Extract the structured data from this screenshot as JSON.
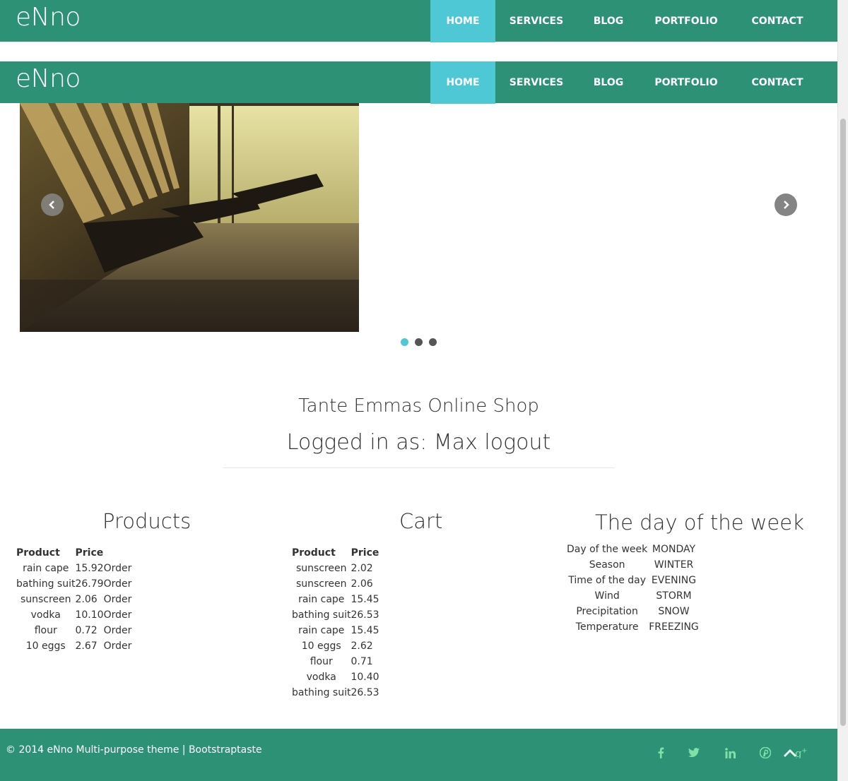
{
  "brand": "eNno",
  "nav": {
    "items": [
      {
        "label": "HOME",
        "active": true
      },
      {
        "label": "SERVICES",
        "active": false
      },
      {
        "label": "BLOG",
        "active": false
      },
      {
        "label": "PORTFOLIO",
        "active": false
      },
      {
        "label": "CONTACT",
        "active": false
      }
    ]
  },
  "carousel": {
    "slide_count": 3,
    "active_index": 0
  },
  "shop": {
    "title": "Tante Emmas Online Shop",
    "login_line": "Logged in as: Max logout"
  },
  "products": {
    "title": "Products",
    "headers": [
      "Product",
      "Price"
    ],
    "rows": [
      {
        "name": "rain cape",
        "price": "15.92",
        "action": "Order"
      },
      {
        "name": "bathing suit",
        "price": "26.79",
        "action": "Order"
      },
      {
        "name": "sunscreen",
        "price": "2.06",
        "action": "Order"
      },
      {
        "name": "vodka",
        "price": "10.10",
        "action": "Order"
      },
      {
        "name": "flour",
        "price": "0.72",
        "action": "Order"
      },
      {
        "name": "10 eggs",
        "price": "2.67",
        "action": "Order"
      }
    ]
  },
  "cart": {
    "title": "Cart",
    "headers": [
      "Product",
      "Price"
    ],
    "rows": [
      {
        "name": "sunscreen",
        "price": "2.02"
      },
      {
        "name": "sunscreen",
        "price": "2.06"
      },
      {
        "name": "rain cape",
        "price": "15.45"
      },
      {
        "name": "bathing suit",
        "price": "26.53"
      },
      {
        "name": "rain cape",
        "price": "15.45"
      },
      {
        "name": "10 eggs",
        "price": "2.62"
      },
      {
        "name": "flour",
        "price": "0.71"
      },
      {
        "name": "vodka",
        "price": "10.40"
      },
      {
        "name": "bathing suit",
        "price": "26.53"
      }
    ]
  },
  "week": {
    "title": "The day of the week",
    "rows": [
      {
        "key": "Day of the week",
        "value": "MONDAY"
      },
      {
        "key": "Season",
        "value": "WINTER"
      },
      {
        "key": "Time of the day",
        "value": "EVENING"
      },
      {
        "key": "Wind",
        "value": "STORM"
      },
      {
        "key": "Precipitation",
        "value": "SNOW"
      },
      {
        "key": "Temperature",
        "value": "FREEZING"
      }
    ]
  },
  "footer": {
    "text": "© 2014 eNno Multi-purpose theme | Bootstraptaste",
    "social_icons": [
      "facebook-icon",
      "twitter-icon",
      "linkedin-icon",
      "pinterest-icon",
      "google-plus-icon"
    ]
  },
  "colors": {
    "nav_bg": "#2d9275",
    "nav_active": "#4fc8d6",
    "social_icon": "#7fe0a8"
  }
}
